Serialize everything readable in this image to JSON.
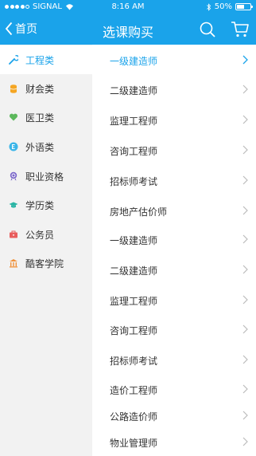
{
  "status_bar": {
    "carrier": "SIGNAL",
    "time": "8:16 AM",
    "battery": "50%",
    "battery_level": 0.5
  },
  "header": {
    "back_label": "首页",
    "title": "选课购买"
  },
  "colors": {
    "accent": "#1aa3ea",
    "sidebar_bg": "#f2f2f2",
    "chevron": "#bbbbbb"
  },
  "sidebar": {
    "items": [
      {
        "label": "工程类",
        "icon": "wrench-icon",
        "color": "#1aa3ea",
        "active": true
      },
      {
        "label": "财会类",
        "icon": "coins-icon",
        "color": "#f5a623"
      },
      {
        "label": "医卫类",
        "icon": "heart-icon",
        "color": "#5cb85c"
      },
      {
        "label": "外语类",
        "icon": "letter-e-icon",
        "color": "#3bb5e8"
      },
      {
        "label": "职业资格",
        "icon": "badge-icon",
        "color": "#7b68c9"
      },
      {
        "label": "学历类",
        "icon": "graduation-cap-icon",
        "color": "#2bb5a5"
      },
      {
        "label": "公务员",
        "icon": "briefcase-icon",
        "color": "#e85c5c"
      },
      {
        "label": "酷客学院",
        "icon": "building-icon",
        "color": "#f0913a"
      }
    ]
  },
  "courses": {
    "items": [
      {
        "label": "一级建造师",
        "active": true
      },
      {
        "label": "二级建造师"
      },
      {
        "label": "监理工程师"
      },
      {
        "label": "咨询工程师"
      },
      {
        "label": "招标师考试"
      },
      {
        "label": "房地产估价师"
      },
      {
        "label": "一级建造师"
      },
      {
        "label": "二级建造师"
      },
      {
        "label": "监理工程师"
      },
      {
        "label": "咨询工程师"
      },
      {
        "label": "招标师考试"
      },
      {
        "label": "造价工程师"
      },
      {
        "label": "公路造价师"
      },
      {
        "label": "物业管理师"
      }
    ]
  }
}
